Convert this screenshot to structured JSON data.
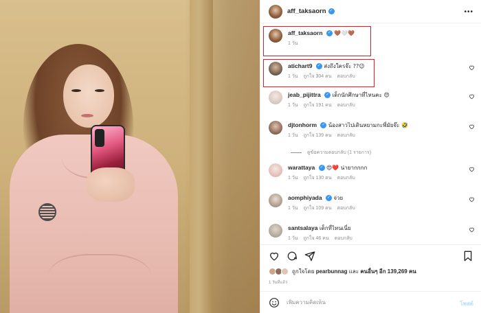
{
  "header": {
    "username": "aff_taksaorn",
    "more_icon": "more-horizontal-icon"
  },
  "caption": {
    "username": "aff_taksaorn",
    "text": "🤎🤍🤎",
    "time": "1 วัน"
  },
  "comments": [
    {
      "username": "atichart9",
      "verified": true,
      "text": "ส่งถึงใครจ๊ะ ??😉",
      "time": "1 วัน",
      "likes": "ถูกใจ 304 คน",
      "reply": "ตอบกลับ"
    },
    {
      "username": "jeab_pijittra",
      "verified": true,
      "text": "เด็กนักศึกษาที่ไหนคะ 😍",
      "time": "1 วัน",
      "likes": "ถูกใจ 191 คน",
      "reply": "ตอบกลับ"
    },
    {
      "username": "djtonhorm",
      "verified": true,
      "text": "น้องสาวไปเดินหยามกะพี่มัยจ๊ะ 🤣",
      "time": "1 วัน",
      "likes": "ถูกใจ 139 คน",
      "reply": "ตอบกลับ"
    },
    {
      "username": "warattaya",
      "verified": true,
      "text": "😍❤️ น่ายากกกก",
      "time": "1 วัน",
      "likes": "ถูกใจ 130 คน",
      "reply": "ตอบกลับ"
    },
    {
      "username": "aomphiyada",
      "verified": true,
      "text": "จ่วย",
      "time": "1 วัน",
      "likes": "ถูกใจ 109 คน",
      "reply": "ตอบกลับ"
    },
    {
      "username": "santsalaya",
      "verified": false,
      "text": "เด็กที่ไหนเนี่ย",
      "time": "1 วัน",
      "likes": "ถูกใจ 46 คน",
      "reply": "ตอบกลับ"
    }
  ],
  "view_replies": "ดูข้อความตอบกลับ (1 รายการ)",
  "likes": {
    "prefix": "ถูกใจโดย",
    "user": "pearbunnag",
    "middle": "และ",
    "others": "คนอื่นๆ อีก 139,269 คน"
  },
  "post_time": "1 วันที่แล้ว",
  "add_comment": {
    "placeholder": "เพิ่มความคิดเห็น",
    "post_label": "โพสต์"
  },
  "colors": {
    "verified": "#3897f0",
    "highlight_box": "#e01b22",
    "secondary_text": "#8e8e8e"
  }
}
